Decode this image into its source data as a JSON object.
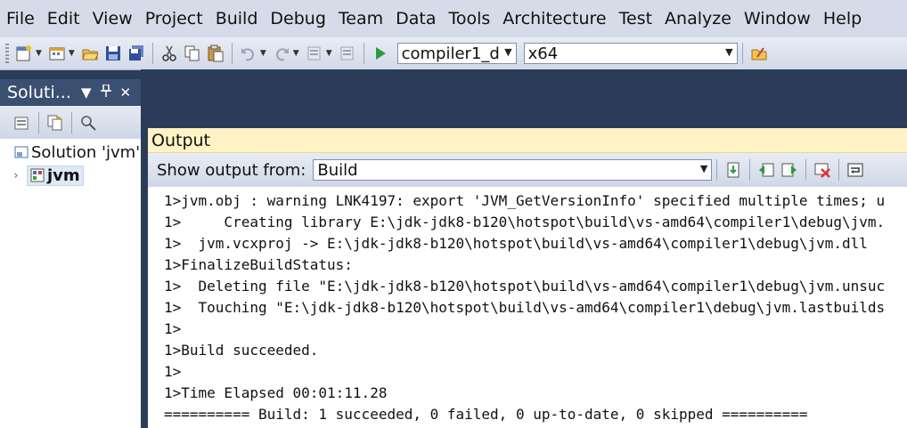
{
  "menu": [
    "File",
    "Edit",
    "View",
    "Project",
    "Build",
    "Debug",
    "Team",
    "Data",
    "Tools",
    "Architecture",
    "Test",
    "Analyze",
    "Window",
    "Help"
  ],
  "toolbar": {
    "config_value": "compiler1_d",
    "platform_value": "x64"
  },
  "solution_explorer": {
    "title": "Soluti...",
    "pin_glyph": "↕",
    "items": [
      {
        "label": "Solution 'jvm'"
      },
      {
        "label": "jvm"
      }
    ]
  },
  "output": {
    "title": "Output",
    "show_from_label": "Show output from:",
    "source_value": "Build",
    "lines": [
      "1>jvm.obj : warning LNK4197: export 'JVM_GetVersionInfo' specified multiple times; u",
      "1>     Creating library E:\\jdk-jdk8-b120\\hotspot\\build\\vs-amd64\\compiler1\\debug\\jvm.",
      "1>  jvm.vcxproj -> E:\\jdk-jdk8-b120\\hotspot\\build\\vs-amd64\\compiler1\\debug\\jvm.dll",
      "1>FinalizeBuildStatus:",
      "1>  Deleting file \"E:\\jdk-jdk8-b120\\hotspot\\build\\vs-amd64\\compiler1\\debug\\jvm.unsuc",
      "1>  Touching \"E:\\jdk-jdk8-b120\\hotspot\\build\\vs-amd64\\compiler1\\debug\\jvm.lastbuilds",
      "1>",
      "1>Build succeeded.",
      "1>",
      "1>Time Elapsed 00:01:11.28",
      "========== Build: 1 succeeded, 0 failed, 0 up-to-date, 0 skipped =========="
    ]
  }
}
